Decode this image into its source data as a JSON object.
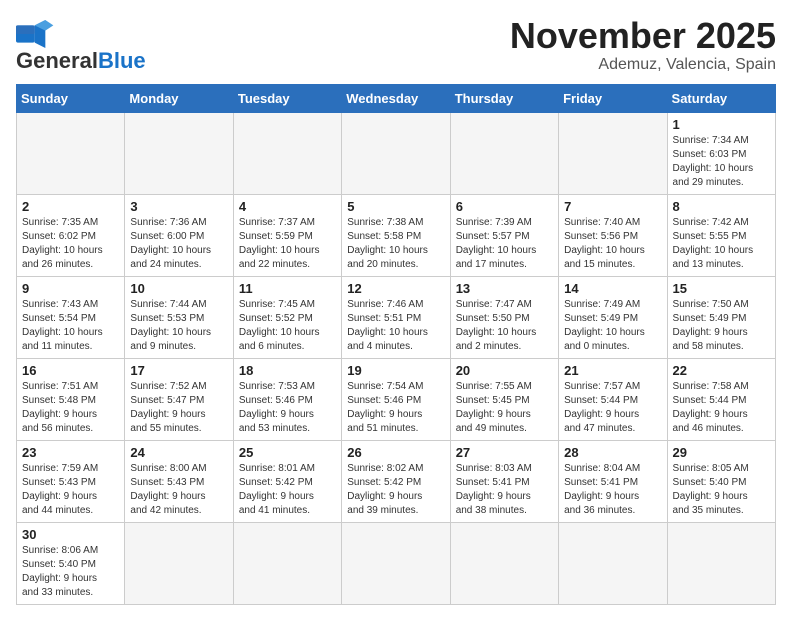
{
  "header": {
    "logo_line1": "General",
    "logo_line2": "Blue",
    "month": "November 2025",
    "location": "Ademuz, Valencia, Spain"
  },
  "days_of_week": [
    "Sunday",
    "Monday",
    "Tuesday",
    "Wednesday",
    "Thursday",
    "Friday",
    "Saturday"
  ],
  "weeks": [
    [
      {
        "day": "",
        "info": ""
      },
      {
        "day": "",
        "info": ""
      },
      {
        "day": "",
        "info": ""
      },
      {
        "day": "",
        "info": ""
      },
      {
        "day": "",
        "info": ""
      },
      {
        "day": "",
        "info": ""
      },
      {
        "day": "1",
        "info": "Sunrise: 7:34 AM\nSunset: 6:03 PM\nDaylight: 10 hours\nand 29 minutes."
      }
    ],
    [
      {
        "day": "2",
        "info": "Sunrise: 7:35 AM\nSunset: 6:02 PM\nDaylight: 10 hours\nand 26 minutes."
      },
      {
        "day": "3",
        "info": "Sunrise: 7:36 AM\nSunset: 6:00 PM\nDaylight: 10 hours\nand 24 minutes."
      },
      {
        "day": "4",
        "info": "Sunrise: 7:37 AM\nSunset: 5:59 PM\nDaylight: 10 hours\nand 22 minutes."
      },
      {
        "day": "5",
        "info": "Sunrise: 7:38 AM\nSunset: 5:58 PM\nDaylight: 10 hours\nand 20 minutes."
      },
      {
        "day": "6",
        "info": "Sunrise: 7:39 AM\nSunset: 5:57 PM\nDaylight: 10 hours\nand 17 minutes."
      },
      {
        "day": "7",
        "info": "Sunrise: 7:40 AM\nSunset: 5:56 PM\nDaylight: 10 hours\nand 15 minutes."
      },
      {
        "day": "8",
        "info": "Sunrise: 7:42 AM\nSunset: 5:55 PM\nDaylight: 10 hours\nand 13 minutes."
      }
    ],
    [
      {
        "day": "9",
        "info": "Sunrise: 7:43 AM\nSunset: 5:54 PM\nDaylight: 10 hours\nand 11 minutes."
      },
      {
        "day": "10",
        "info": "Sunrise: 7:44 AM\nSunset: 5:53 PM\nDaylight: 10 hours\nand 9 minutes."
      },
      {
        "day": "11",
        "info": "Sunrise: 7:45 AM\nSunset: 5:52 PM\nDaylight: 10 hours\nand 6 minutes."
      },
      {
        "day": "12",
        "info": "Sunrise: 7:46 AM\nSunset: 5:51 PM\nDaylight: 10 hours\nand 4 minutes."
      },
      {
        "day": "13",
        "info": "Sunrise: 7:47 AM\nSunset: 5:50 PM\nDaylight: 10 hours\nand 2 minutes."
      },
      {
        "day": "14",
        "info": "Sunrise: 7:49 AM\nSunset: 5:49 PM\nDaylight: 10 hours\nand 0 minutes."
      },
      {
        "day": "15",
        "info": "Sunrise: 7:50 AM\nSunset: 5:49 PM\nDaylight: 9 hours\nand 58 minutes."
      }
    ],
    [
      {
        "day": "16",
        "info": "Sunrise: 7:51 AM\nSunset: 5:48 PM\nDaylight: 9 hours\nand 56 minutes."
      },
      {
        "day": "17",
        "info": "Sunrise: 7:52 AM\nSunset: 5:47 PM\nDaylight: 9 hours\nand 55 minutes."
      },
      {
        "day": "18",
        "info": "Sunrise: 7:53 AM\nSunset: 5:46 PM\nDaylight: 9 hours\nand 53 minutes."
      },
      {
        "day": "19",
        "info": "Sunrise: 7:54 AM\nSunset: 5:46 PM\nDaylight: 9 hours\nand 51 minutes."
      },
      {
        "day": "20",
        "info": "Sunrise: 7:55 AM\nSunset: 5:45 PM\nDaylight: 9 hours\nand 49 minutes."
      },
      {
        "day": "21",
        "info": "Sunrise: 7:57 AM\nSunset: 5:44 PM\nDaylight: 9 hours\nand 47 minutes."
      },
      {
        "day": "22",
        "info": "Sunrise: 7:58 AM\nSunset: 5:44 PM\nDaylight: 9 hours\nand 46 minutes."
      }
    ],
    [
      {
        "day": "23",
        "info": "Sunrise: 7:59 AM\nSunset: 5:43 PM\nDaylight: 9 hours\nand 44 minutes."
      },
      {
        "day": "24",
        "info": "Sunrise: 8:00 AM\nSunset: 5:43 PM\nDaylight: 9 hours\nand 42 minutes."
      },
      {
        "day": "25",
        "info": "Sunrise: 8:01 AM\nSunset: 5:42 PM\nDaylight: 9 hours\nand 41 minutes."
      },
      {
        "day": "26",
        "info": "Sunrise: 8:02 AM\nSunset: 5:42 PM\nDaylight: 9 hours\nand 39 minutes."
      },
      {
        "day": "27",
        "info": "Sunrise: 8:03 AM\nSunset: 5:41 PM\nDaylight: 9 hours\nand 38 minutes."
      },
      {
        "day": "28",
        "info": "Sunrise: 8:04 AM\nSunset: 5:41 PM\nDaylight: 9 hours\nand 36 minutes."
      },
      {
        "day": "29",
        "info": "Sunrise: 8:05 AM\nSunset: 5:40 PM\nDaylight: 9 hours\nand 35 minutes."
      }
    ],
    [
      {
        "day": "30",
        "info": "Sunrise: 8:06 AM\nSunset: 5:40 PM\nDaylight: 9 hours\nand 33 minutes."
      },
      {
        "day": "",
        "info": ""
      },
      {
        "day": "",
        "info": ""
      },
      {
        "day": "",
        "info": ""
      },
      {
        "day": "",
        "info": ""
      },
      {
        "day": "",
        "info": ""
      },
      {
        "day": "",
        "info": ""
      }
    ]
  ]
}
